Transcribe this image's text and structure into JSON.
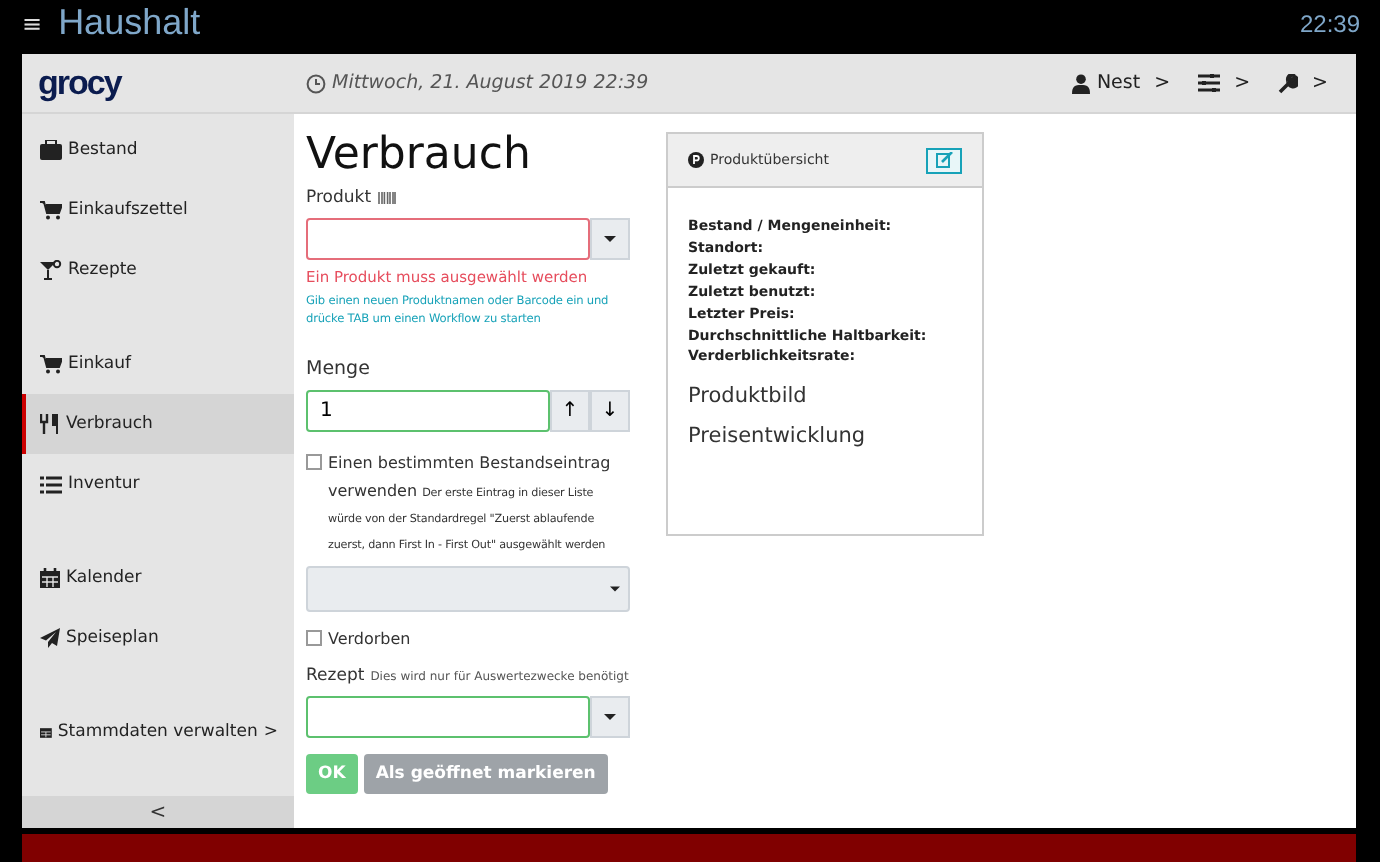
{
  "topbar": {
    "menu_glyph": "≡",
    "title": "Haushalt",
    "clock": "22:39"
  },
  "header": {
    "logo": "grocy",
    "datetime": "Mittwoch, 21. August 2019 22:39",
    "user": "Nest",
    "chevrons": [
      ">",
      ">",
      ">"
    ]
  },
  "sidebar": {
    "groups": [
      [
        {
          "label": "Bestand",
          "selected": false
        },
        {
          "label": "Einkaufszettel",
          "selected": false
        },
        {
          "label": "Rezepte",
          "selected": false
        }
      ],
      [
        {
          "label": "Einkauf",
          "selected": false
        },
        {
          "label": "Verbrauch",
          "selected": true
        },
        {
          "label": "Inventur",
          "selected": false
        }
      ],
      [
        {
          "label": "Kalender",
          "selected": false
        },
        {
          "label": "Speiseplan",
          "selected": false
        }
      ],
      [
        {
          "label": "Stammdaten verwalten",
          "selected": false,
          "chevron": ">"
        }
      ]
    ],
    "collapse": "<"
  },
  "form": {
    "title": "Verbrauch",
    "product": {
      "label": "Produkt",
      "error": "Ein Produkt muss ausgewählt werden",
      "hint": "Gib einen neuen Produktnamen oder Barcode ein und drücke TAB um einen Workflow zu starten"
    },
    "amount": {
      "label": "Menge",
      "value": "1",
      "up": "↑",
      "down": "↓"
    },
    "specific_entry": {
      "checked": false,
      "label": "Einen bestimmten Bestandseintrag verwenden",
      "hint": "Der erste Eintrag in dieser Liste würde von der Standardregel \"Zuerst ablaufende zuerst, dann First In - First Out\" ausgewählt werden"
    },
    "spoiled": {
      "checked": false,
      "label": "Verdorben"
    },
    "recipe": {
      "label": "Rezept",
      "hint": "Dies wird nur für Auswertezwecke benötigt"
    },
    "buttons": [
      {
        "label": "OK",
        "kind": "primary"
      },
      {
        "label": "Als geöffnet markieren",
        "kind": "secondary"
      }
    ]
  },
  "product_card": {
    "title": "Produktübersicht",
    "fields": [
      "Bestand / Mengeneinheit:",
      "Standort:",
      "Zuletzt gekauft:",
      "Zuletzt benutzt:",
      "Letzter Preis:",
      "Durchschnittliche Haltbarkeit:",
      "Verderblichkeitsrate:"
    ],
    "sections": [
      "Produktbild",
      "Preisentwicklung"
    ]
  }
}
